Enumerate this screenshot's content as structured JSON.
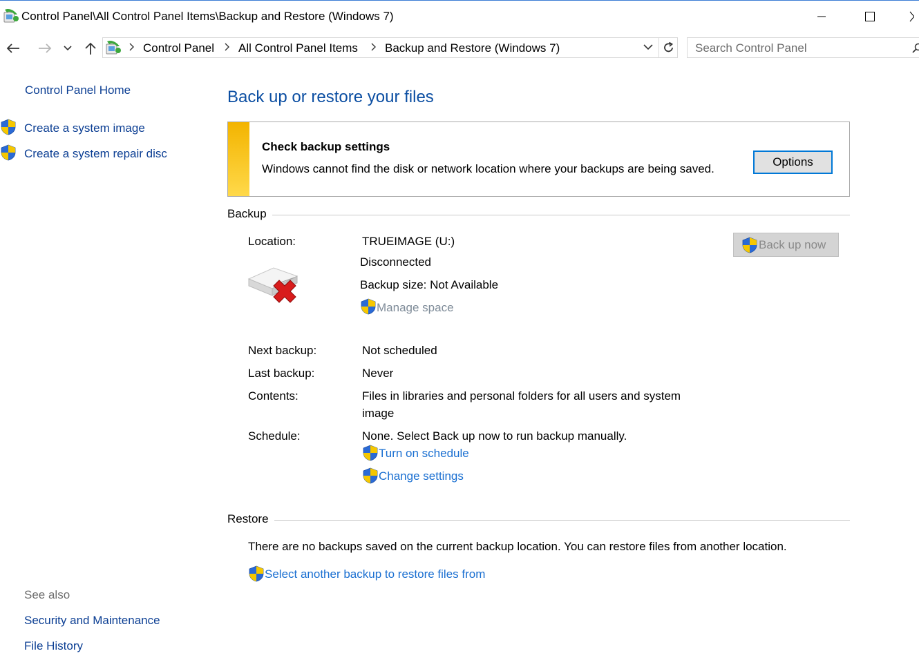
{
  "window": {
    "title": "Control Panel\\All Control Panel Items\\Backup and Restore (Windows 7)"
  },
  "address": {
    "crumbs": [
      "Control Panel",
      "All Control Panel Items",
      "Backup and Restore (Windows 7)"
    ]
  },
  "search": {
    "placeholder": "Search Control Panel"
  },
  "sidebar": {
    "home": "Control Panel Home",
    "links": [
      "Create a system image",
      "Create a system repair disc"
    ],
    "see_also_title": "See also",
    "see_also": [
      "Security and Maintenance",
      "File History"
    ]
  },
  "main": {
    "heading": "Back up or restore your files",
    "alert": {
      "title": "Check backup settings",
      "message": "Windows cannot find the disk or network location where your backups are being saved.",
      "options_label": "Options"
    },
    "backup": {
      "section_title": "Backup",
      "location_label": "Location:",
      "location_value": "TRUEIMAGE (U:)",
      "status": "Disconnected",
      "size": "Backup size: Not Available",
      "manage_space": "Manage space",
      "back_up_now": "Back up now",
      "next_label": "Next backup:",
      "next_value": "Not scheduled",
      "last_label": "Last backup:",
      "last_value": "Never",
      "contents_label": "Contents:",
      "contents_line1": "Files in libraries and personal folders for all users and system",
      "contents_line2": "image",
      "schedule_label": "Schedule:",
      "schedule_value": "None. Select Back up now to run backup manually.",
      "turn_on_schedule": "Turn on schedule",
      "change_settings": "Change settings"
    },
    "restore": {
      "section_title": "Restore",
      "message": "There are no backups saved on the current backup location. You can restore files from another location.",
      "select_link": "Select another backup to restore files from"
    }
  },
  "colors": {
    "link": "#1a6fd1",
    "heading": "#0b4ea2",
    "alert_bar": "#f3b400",
    "shield_blue": "#2a6ad6",
    "shield_yellow": "#f6c700"
  }
}
